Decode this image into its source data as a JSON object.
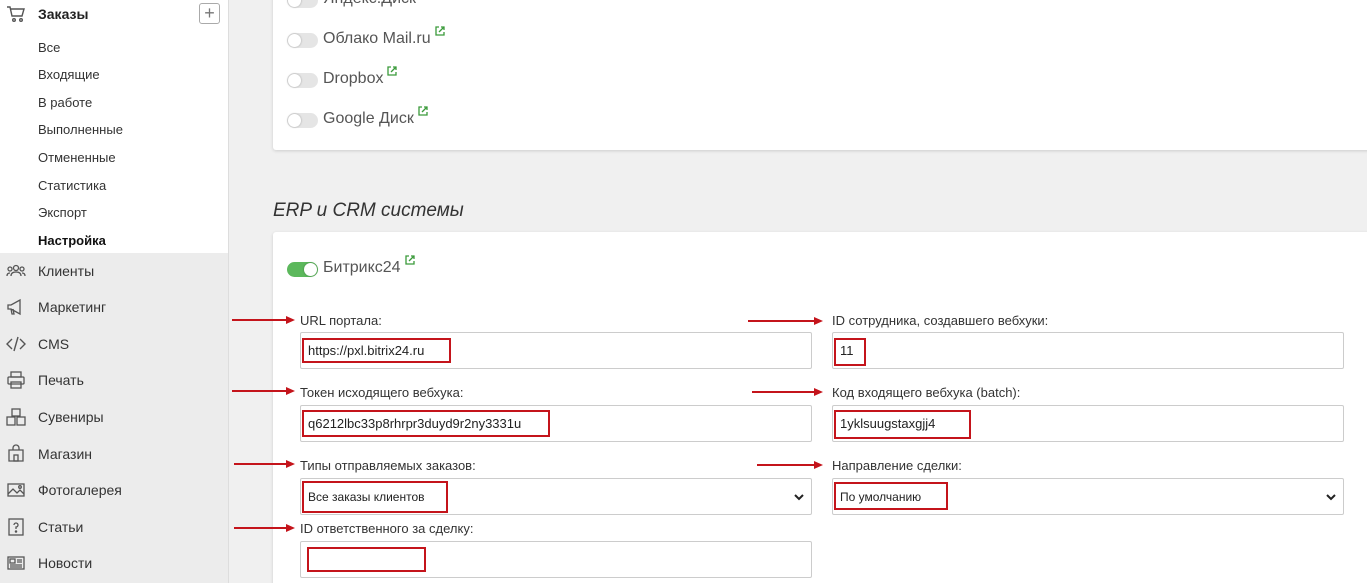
{
  "sidebar": {
    "orders_title": "Заказы",
    "plus": "+",
    "subitems": [
      "Все",
      "Входящие",
      "В работе",
      "Выполненные",
      "Отмененные",
      "Статистика",
      "Экспорт",
      "Настройка"
    ],
    "nav": [
      "Клиенты",
      "Маркетинг",
      "CMS",
      "Печать",
      "Сувениры",
      "Магазин",
      "Фотогалерея",
      "Статьи",
      "Новости"
    ]
  },
  "storage": {
    "items": [
      "Яндекс.Диск",
      "Облако Mail.ru",
      "Dropbox",
      "Google Диск"
    ]
  },
  "erp": {
    "section_title": "ERP и CRM системы",
    "bitrix_label": "Битрикс24",
    "bitrix_enabled": true,
    "fields": {
      "portal_url_label": "URL портала:",
      "portal_url_value": "https://pxl.bitrix24.ru",
      "employee_id_label": "ID сотрудника, создавшего вебхуки:",
      "employee_id_value": "11",
      "out_token_label": "Токен исходящего вебхука:",
      "out_token_value": "q6212lbc33p8rhrpr3duyd9r2ny3331u",
      "in_code_label": "Код входящего вебхука (batch):",
      "in_code_value": "1yklsuugstaxgjj4",
      "order_types_label": "Типы отправляемых заказов:",
      "order_types_value": "Все заказы клиентов",
      "deal_direction_label": "Направление сделки:",
      "deal_direction_value": "По умолчанию",
      "responsible_id_label": "ID ответственного за сделку:",
      "responsible_id_value": ""
    }
  },
  "colors": {
    "highlight": "#c4141b",
    "toggle_on": "#5cb85c",
    "link_icon": "#3a9a3a"
  }
}
